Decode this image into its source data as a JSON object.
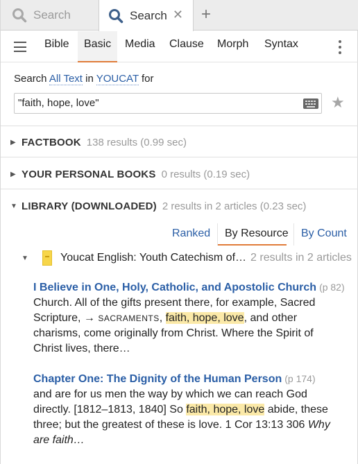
{
  "tabs": [
    {
      "label": "Search",
      "active": false
    },
    {
      "label": "Search",
      "active": true,
      "close": "✕"
    }
  ],
  "new_tab": "+",
  "modes": [
    "Bible",
    "Basic",
    "Media",
    "Clause",
    "Morph",
    "Syntax"
  ],
  "active_mode": "Basic",
  "search": {
    "prefix": "Search",
    "scope": "All Text",
    "in": "in",
    "resource": "YOUCAT",
    "for": "for",
    "query": "\"faith, hope, love\""
  },
  "sections": [
    {
      "title": "FACTBOOK",
      "count": "138 results (0.99 sec)",
      "expanded": false
    },
    {
      "title": "YOUR PERSONAL BOOKS",
      "count": "0 results (0.19 sec)",
      "expanded": false
    },
    {
      "title": "LIBRARY (DOWNLOADED)",
      "count": "2 results in 2 articles (0.23 sec)",
      "expanded": true
    }
  ],
  "sort_options": [
    "Ranked",
    "By Resource",
    "By Count"
  ],
  "active_sort": "By Resource",
  "resource": {
    "title": "Youcat English: Youth Catechism of…",
    "count": "2 results in 2 articles"
  },
  "hits": [
    {
      "title": "I Believe in One, Holy, Catholic, and Apostolic Church",
      "page": "(p 82)",
      "line1": "Church. All of the gifts present there, for example, Sacred",
      "line2_a": "Scripture, → ",
      "line2_sc": "SACRAMENTS",
      "line2_b": ", ",
      "highlight": "faith, hope, love",
      "line2_c": ", and other",
      "line3": "charisms, come originally from Christ. Where the Spirit of",
      "line4": "Christ lives, there…"
    },
    {
      "title": "Chapter One: The Dignity of the Human Person",
      "page": "(p 174)",
      "line1": "and are for us men the way by which we can reach God",
      "line2_a": "directly. [1812–1813, 1840]  So ",
      "highlight": "faith, hope, love",
      "line2_c": " abide, these",
      "line3": "three; but the greatest of these is love. 1 Cor 13:13 306 ",
      "line3_it": "Why",
      "line4_it": "are faith…"
    }
  ],
  "colors": {
    "link": "#2a5ea6",
    "accent": "#e07b39",
    "highlight": "#fbe9a8",
    "muted": "#9a9a9a"
  },
  "icons": [
    "search-icon",
    "close-icon",
    "plus-icon",
    "hamburger-icon",
    "kebab-icon",
    "keyboard-icon",
    "star-icon",
    "caret-icon",
    "book-icon"
  ]
}
